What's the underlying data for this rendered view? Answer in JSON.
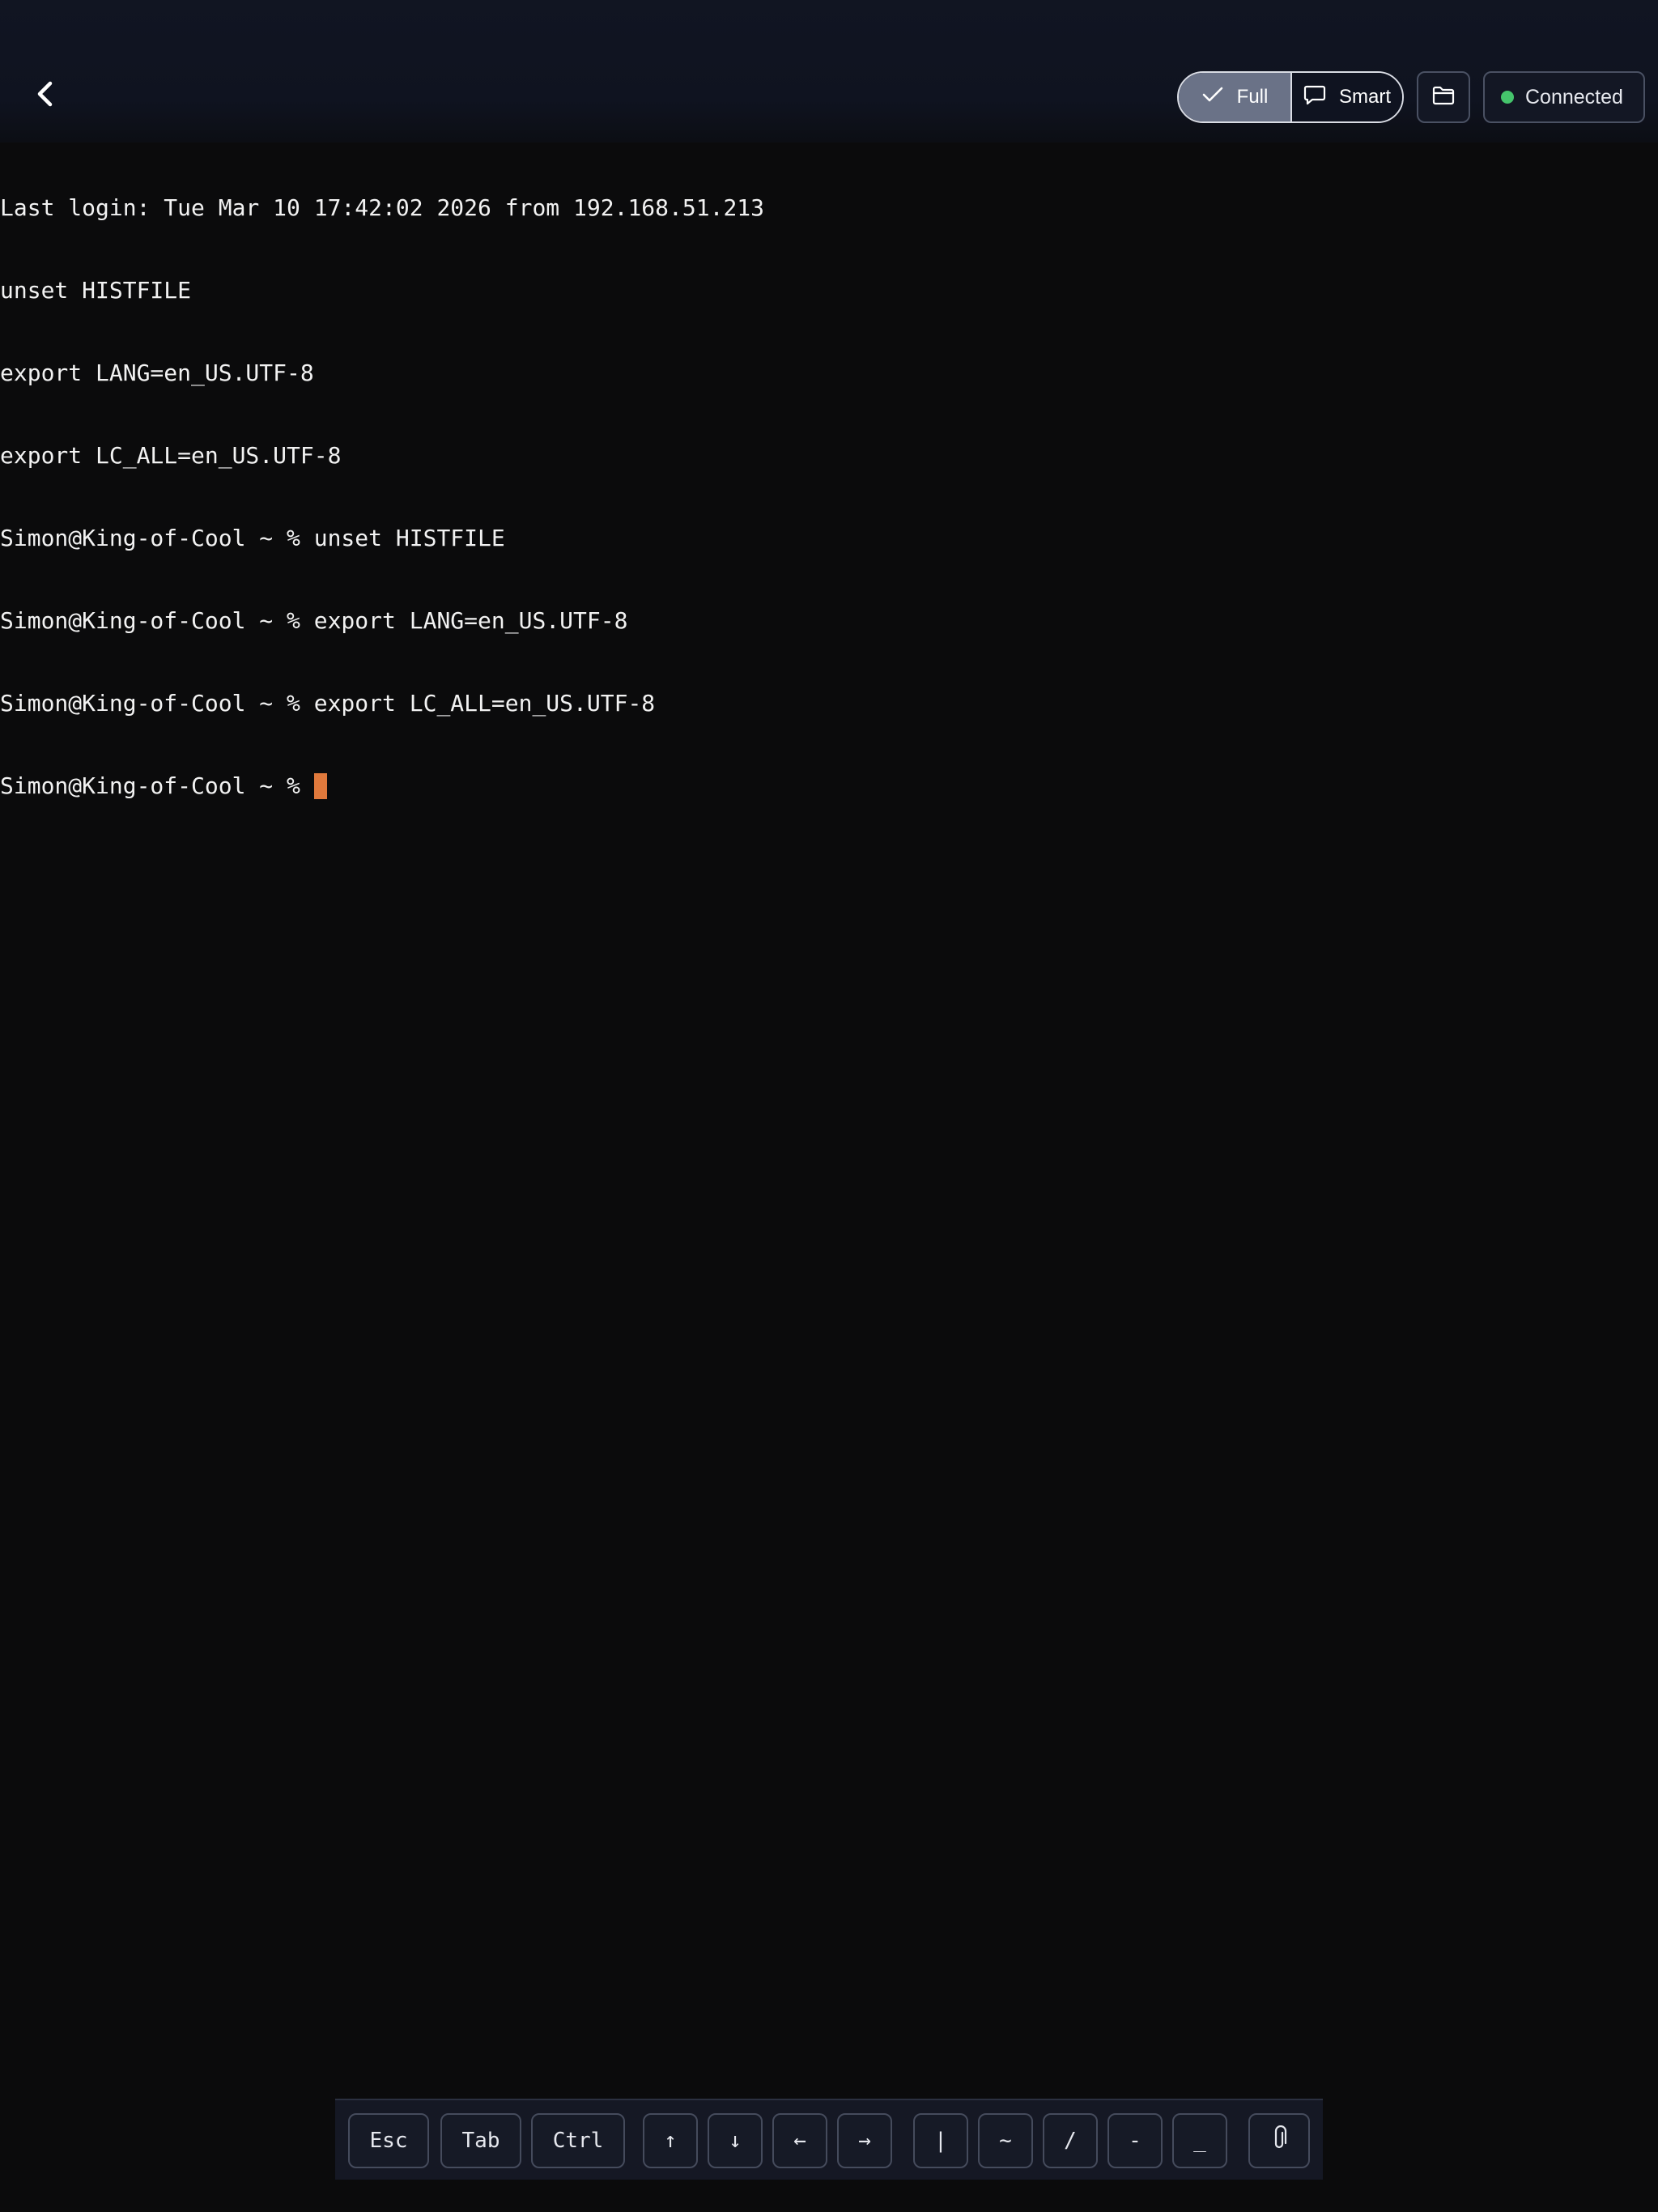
{
  "header": {
    "mode_full_label": "Full",
    "mode_smart_label": "Smart",
    "selected_mode": "Full",
    "status_label": "Connected",
    "status_color": "#45c46c"
  },
  "icons": {
    "back": "chevron-left-icon",
    "full": "check-icon",
    "smart": "chat-bubble-icon",
    "folder": "folder-icon",
    "attach": "paperclip-icon"
  },
  "terminal": {
    "lines": [
      "Last login: Tue Mar 10 17:42:02 2026 from 192.168.51.213",
      "unset HISTFILE",
      "export LANG=en_US.UTF-8",
      "export LC_ALL=en_US.UTF-8",
      "Simon@King-of-Cool ~ % unset HISTFILE",
      "Simon@King-of-Cool ~ % export LANG=en_US.UTF-8",
      "Simon@King-of-Cool ~ % export LC_ALL=en_US.UTF-8"
    ],
    "prompt": "Simon@King-of-Cool ~ % ",
    "cursor_color": "#e0793c"
  },
  "keys": {
    "esc": "Esc",
    "tab": "Tab",
    "ctrl": "Ctrl",
    "up": "↑",
    "down": "↓",
    "left": "←",
    "right": "→",
    "pipe": "|",
    "tilde": "~",
    "slash": "/",
    "dash": "-",
    "underscore": "_"
  }
}
